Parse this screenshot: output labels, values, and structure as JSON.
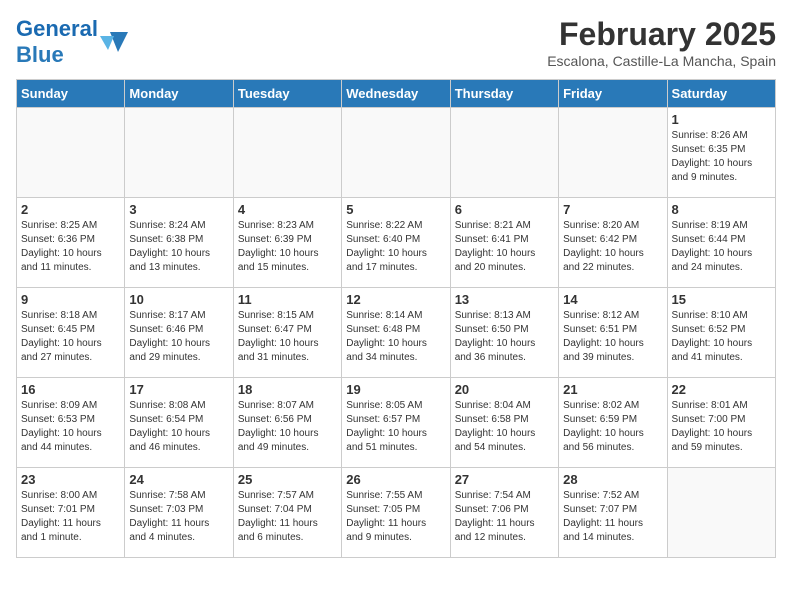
{
  "header": {
    "logo_general": "General",
    "logo_blue": "Blue",
    "month_title": "February 2025",
    "location": "Escalona, Castille-La Mancha, Spain"
  },
  "days_of_week": [
    "Sunday",
    "Monday",
    "Tuesday",
    "Wednesday",
    "Thursday",
    "Friday",
    "Saturday"
  ],
  "weeks": [
    [
      {
        "day": "",
        "info": ""
      },
      {
        "day": "",
        "info": ""
      },
      {
        "day": "",
        "info": ""
      },
      {
        "day": "",
        "info": ""
      },
      {
        "day": "",
        "info": ""
      },
      {
        "day": "",
        "info": ""
      },
      {
        "day": "1",
        "info": "Sunrise: 8:26 AM\nSunset: 6:35 PM\nDaylight: 10 hours\nand 9 minutes."
      }
    ],
    [
      {
        "day": "2",
        "info": "Sunrise: 8:25 AM\nSunset: 6:36 PM\nDaylight: 10 hours\nand 11 minutes."
      },
      {
        "day": "3",
        "info": "Sunrise: 8:24 AM\nSunset: 6:38 PM\nDaylight: 10 hours\nand 13 minutes."
      },
      {
        "day": "4",
        "info": "Sunrise: 8:23 AM\nSunset: 6:39 PM\nDaylight: 10 hours\nand 15 minutes."
      },
      {
        "day": "5",
        "info": "Sunrise: 8:22 AM\nSunset: 6:40 PM\nDaylight: 10 hours\nand 17 minutes."
      },
      {
        "day": "6",
        "info": "Sunrise: 8:21 AM\nSunset: 6:41 PM\nDaylight: 10 hours\nand 20 minutes."
      },
      {
        "day": "7",
        "info": "Sunrise: 8:20 AM\nSunset: 6:42 PM\nDaylight: 10 hours\nand 22 minutes."
      },
      {
        "day": "8",
        "info": "Sunrise: 8:19 AM\nSunset: 6:44 PM\nDaylight: 10 hours\nand 24 minutes."
      }
    ],
    [
      {
        "day": "9",
        "info": "Sunrise: 8:18 AM\nSunset: 6:45 PM\nDaylight: 10 hours\nand 27 minutes."
      },
      {
        "day": "10",
        "info": "Sunrise: 8:17 AM\nSunset: 6:46 PM\nDaylight: 10 hours\nand 29 minutes."
      },
      {
        "day": "11",
        "info": "Sunrise: 8:15 AM\nSunset: 6:47 PM\nDaylight: 10 hours\nand 31 minutes."
      },
      {
        "day": "12",
        "info": "Sunrise: 8:14 AM\nSunset: 6:48 PM\nDaylight: 10 hours\nand 34 minutes."
      },
      {
        "day": "13",
        "info": "Sunrise: 8:13 AM\nSunset: 6:50 PM\nDaylight: 10 hours\nand 36 minutes."
      },
      {
        "day": "14",
        "info": "Sunrise: 8:12 AM\nSunset: 6:51 PM\nDaylight: 10 hours\nand 39 minutes."
      },
      {
        "day": "15",
        "info": "Sunrise: 8:10 AM\nSunset: 6:52 PM\nDaylight: 10 hours\nand 41 minutes."
      }
    ],
    [
      {
        "day": "16",
        "info": "Sunrise: 8:09 AM\nSunset: 6:53 PM\nDaylight: 10 hours\nand 44 minutes."
      },
      {
        "day": "17",
        "info": "Sunrise: 8:08 AM\nSunset: 6:54 PM\nDaylight: 10 hours\nand 46 minutes."
      },
      {
        "day": "18",
        "info": "Sunrise: 8:07 AM\nSunset: 6:56 PM\nDaylight: 10 hours\nand 49 minutes."
      },
      {
        "day": "19",
        "info": "Sunrise: 8:05 AM\nSunset: 6:57 PM\nDaylight: 10 hours\nand 51 minutes."
      },
      {
        "day": "20",
        "info": "Sunrise: 8:04 AM\nSunset: 6:58 PM\nDaylight: 10 hours\nand 54 minutes."
      },
      {
        "day": "21",
        "info": "Sunrise: 8:02 AM\nSunset: 6:59 PM\nDaylight: 10 hours\nand 56 minutes."
      },
      {
        "day": "22",
        "info": "Sunrise: 8:01 AM\nSunset: 7:00 PM\nDaylight: 10 hours\nand 59 minutes."
      }
    ],
    [
      {
        "day": "23",
        "info": "Sunrise: 8:00 AM\nSunset: 7:01 PM\nDaylight: 11 hours\nand 1 minute."
      },
      {
        "day": "24",
        "info": "Sunrise: 7:58 AM\nSunset: 7:03 PM\nDaylight: 11 hours\nand 4 minutes."
      },
      {
        "day": "25",
        "info": "Sunrise: 7:57 AM\nSunset: 7:04 PM\nDaylight: 11 hours\nand 6 minutes."
      },
      {
        "day": "26",
        "info": "Sunrise: 7:55 AM\nSunset: 7:05 PM\nDaylight: 11 hours\nand 9 minutes."
      },
      {
        "day": "27",
        "info": "Sunrise: 7:54 AM\nSunset: 7:06 PM\nDaylight: 11 hours\nand 12 minutes."
      },
      {
        "day": "28",
        "info": "Sunrise: 7:52 AM\nSunset: 7:07 PM\nDaylight: 11 hours\nand 14 minutes."
      },
      {
        "day": "",
        "info": ""
      }
    ]
  ]
}
